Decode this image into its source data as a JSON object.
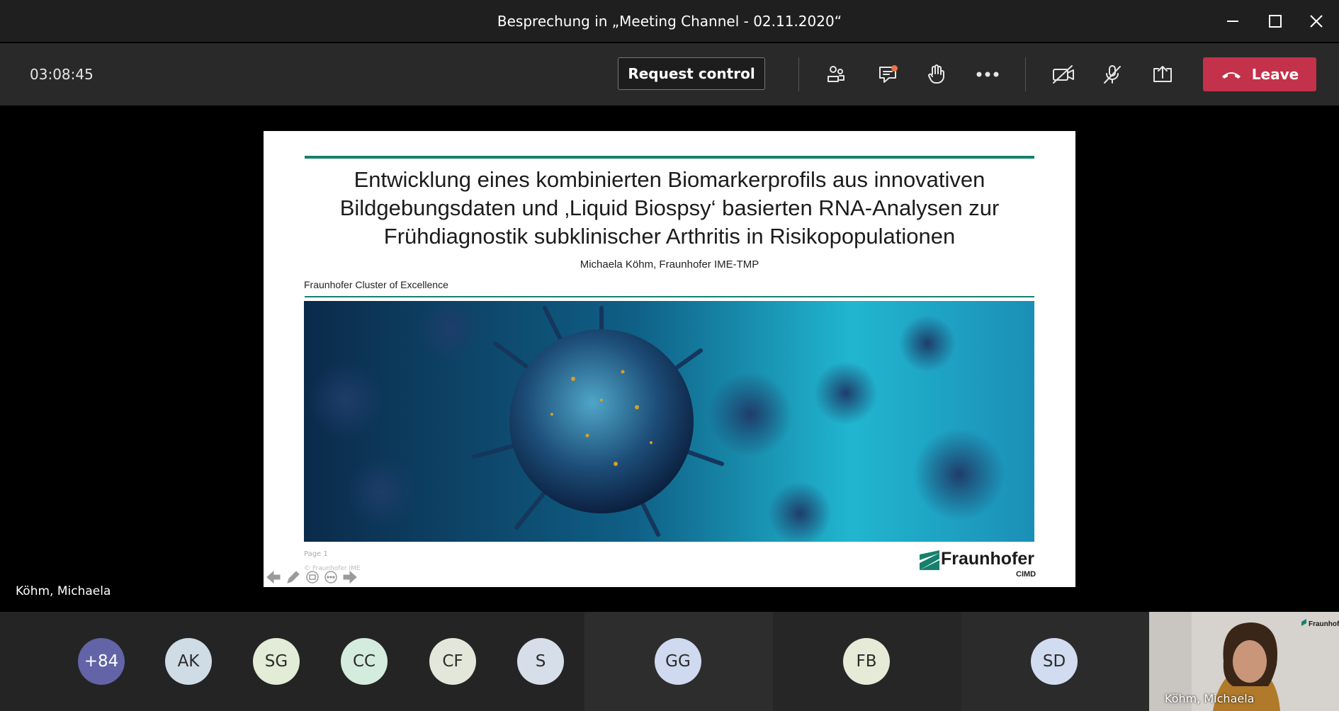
{
  "window": {
    "title": "Besprechung in „Meeting Channel - 02.11.2020“"
  },
  "toolbar": {
    "timer": "03:08:45",
    "request_control": "Request control",
    "leave": "Leave",
    "icons": [
      "participants-icon",
      "chat-icon",
      "raise-hand-icon",
      "more-icon",
      "camera-off-icon",
      "mic-off-icon",
      "share-icon"
    ],
    "chat_badge_color": "#e97548",
    "leave_color": "#c4314b"
  },
  "slide": {
    "title_lines": [
      "Entwicklung eines kombinierten Biomarkerprofils aus innovativen",
      "Bildgebungsdaten und ‚Liquid Biospsy‘ basierten RNA-Analysen zur",
      "Frühdiagnostik subklinischer Arthritis in Risikopopulationen"
    ],
    "author": "Michaela Köhm, Fraunhofer IME-TMP",
    "cluster": "Fraunhofer Cluster of Excellence",
    "page": "Page 1",
    "copyright": "© Fraunhofer IME",
    "logo_text": "Fraunhofer",
    "logo_subtext": "CIMD",
    "accent_color": "#17806d"
  },
  "presenter": {
    "name": "Köhm, Michaela"
  },
  "participants": [
    {
      "initials": "+84",
      "color": "#6264a7",
      "text_color": "#ffffff"
    },
    {
      "initials": "AK",
      "color": "#cfdce6"
    },
    {
      "initials": "SG",
      "color": "#e3ecd6"
    },
    {
      "initials": "CC",
      "color": "#d4ecdd"
    },
    {
      "initials": "CF",
      "color": "#e2e7da"
    },
    {
      "initials": "S",
      "color": "#d6dfe9"
    },
    {
      "initials": "GG",
      "color": "#cfd9ef"
    },
    {
      "initials": "FB",
      "color": "#e6ebd8"
    },
    {
      "initials": "SD",
      "color": "#d1dcf0"
    }
  ],
  "self_view": {
    "name": "Köhm, Michaela",
    "logo_text": "Fraunhofer"
  }
}
